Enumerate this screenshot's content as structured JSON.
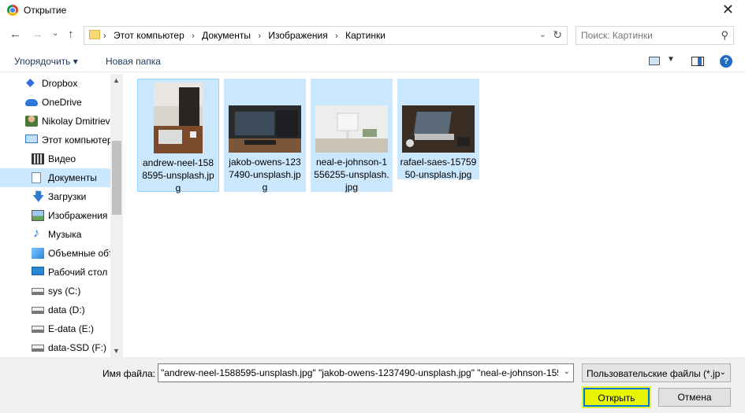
{
  "window": {
    "title": "Открытие"
  },
  "address": {
    "crumbs": [
      "Этот компьютер",
      "Документы",
      "Изображения",
      "Картинки"
    ],
    "search_placeholder": "Поиск: Картинки"
  },
  "toolbar": {
    "organize": "Упорядочить ▾",
    "new_folder": "Новая папка"
  },
  "nav": {
    "items": [
      {
        "label": "Dropbox",
        "icon": "dropbox-icon"
      },
      {
        "label": "OneDrive",
        "icon": "cloud-icon"
      },
      {
        "label": "Nikolay Dmitriev",
        "icon": "user-icon"
      },
      {
        "label": "Этот компьютер",
        "icon": "computer-icon"
      },
      {
        "label": "Видео",
        "icon": "video-icon"
      },
      {
        "label": "Документы",
        "icon": "documents-icon",
        "selected": true
      },
      {
        "label": "Загрузки",
        "icon": "downloads-icon"
      },
      {
        "label": "Изображения",
        "icon": "pictures-icon"
      },
      {
        "label": "Музыка",
        "icon": "music-icon"
      },
      {
        "label": "Объемные объекты",
        "icon": "3d-objects-icon"
      },
      {
        "label": "Рабочий стол",
        "icon": "desktop-icon"
      },
      {
        "label": "sys (C:)",
        "icon": "drive-icon"
      },
      {
        "label": "data (D:)",
        "icon": "drive-icon"
      },
      {
        "label": "E-data (E:)",
        "icon": "drive-icon"
      },
      {
        "label": "data-SSD (F:)",
        "icon": "drive-icon"
      }
    ]
  },
  "files": [
    {
      "name": "andrew-neel-1588595-unsplash.jpg",
      "display": "andrew-neel-158\n8595-unsplash.jp\ng"
    },
    {
      "name": "jakob-owens-1237490-unsplash.jpg",
      "display": "jakob-owens-123\n7490-unsplash.jp\ng"
    },
    {
      "name": "neal-e-johnson-1556255-unsplash.jpg",
      "display": "neal-e-johnson-1\n556255-unsplash.\njpg"
    },
    {
      "name": "rafael-saes-1575950-unsplash.jpg",
      "display": "rafael-saes-15759\n50-unsplash.jpg"
    }
  ],
  "bottom": {
    "filename_label": "Имя файла:",
    "filename_value": "\"andrew-neel-1588595-unsplash.jpg\" \"jakob-owens-1237490-unsplash.jpg\" \"neal-e-johnson-155",
    "filter": "Пользовательские файлы (*.jp",
    "open_label": "Открыть",
    "cancel_label": "Отмена"
  }
}
